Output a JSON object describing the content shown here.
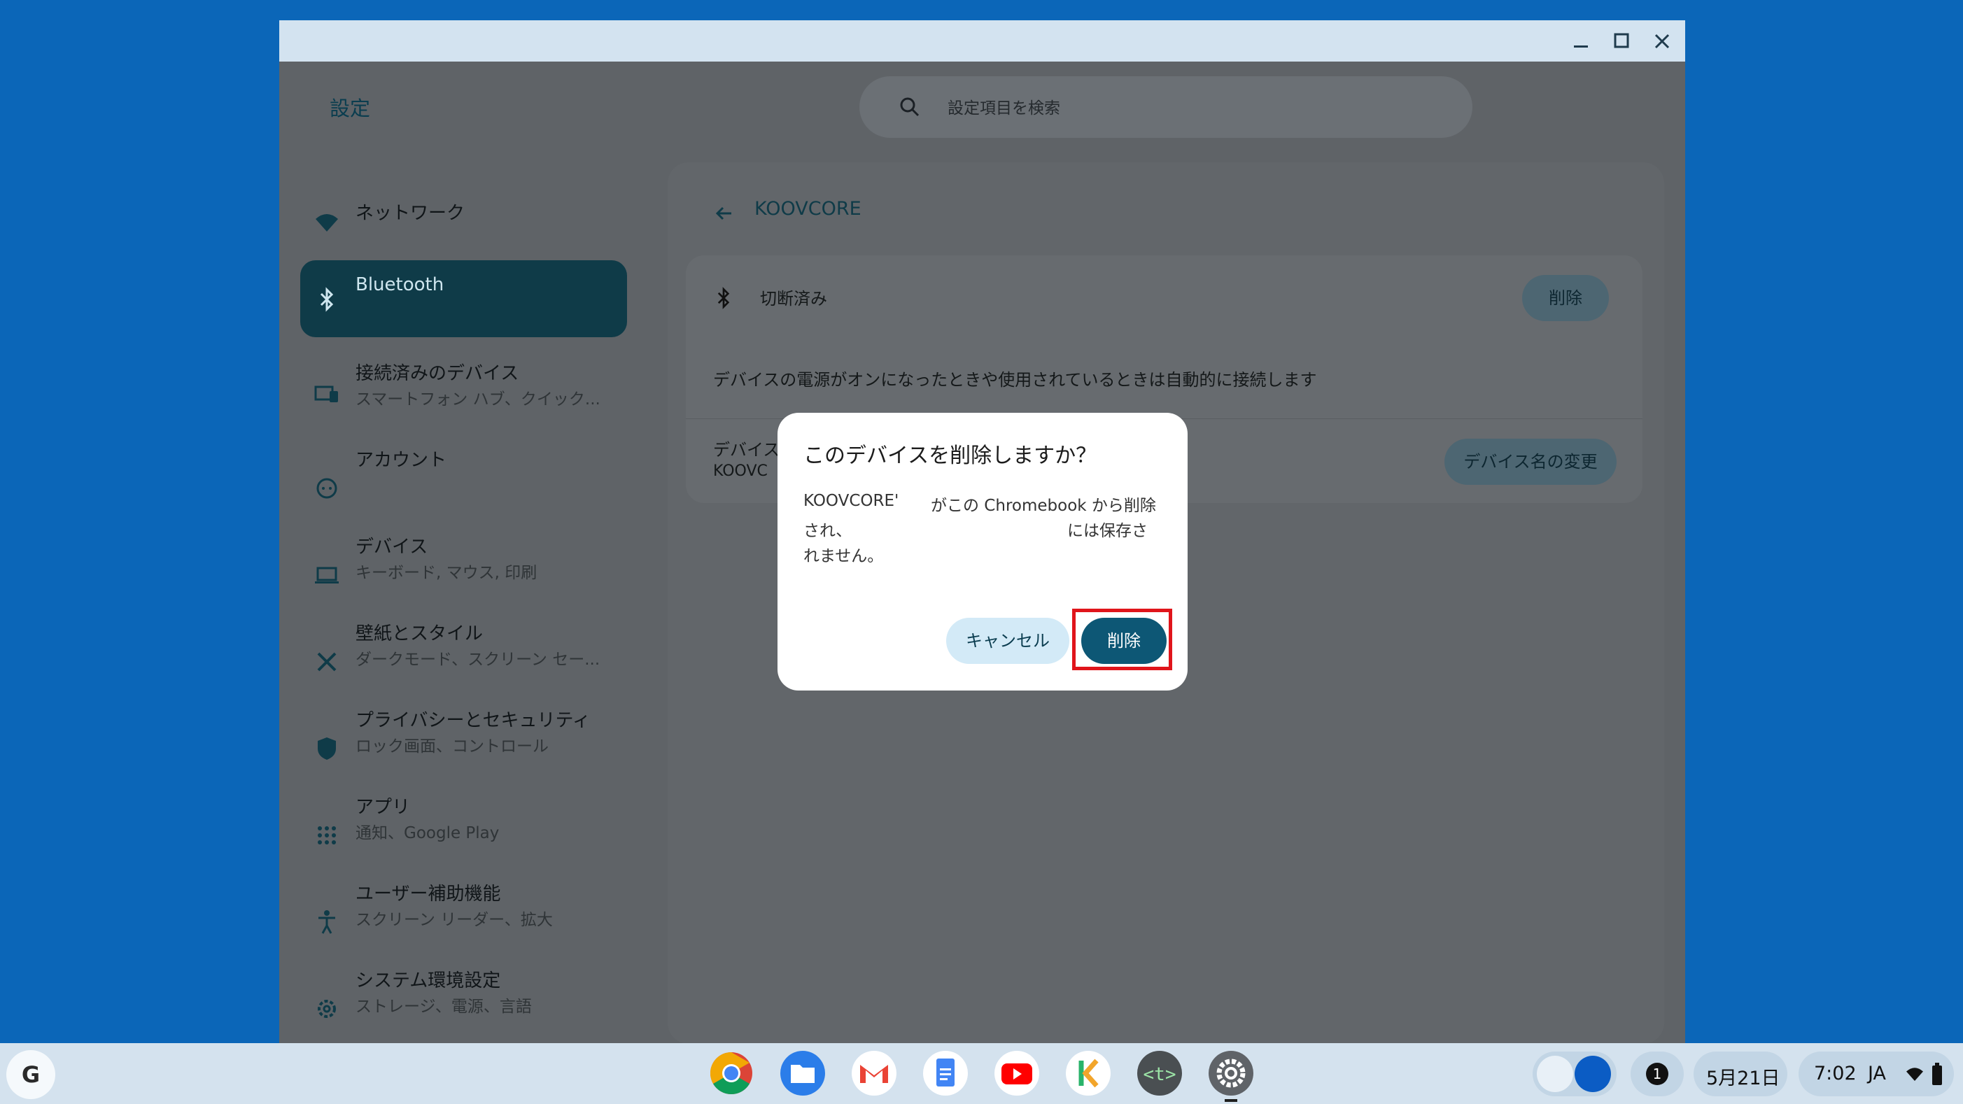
{
  "window": {
    "app_title": "設定",
    "search_placeholder": "設定項目を検索"
  },
  "sidebar": {
    "items": [
      {
        "title": "ネットワーク",
        "subtitle": "",
        "icon": "wifi-icon"
      },
      {
        "title": "Bluetooth",
        "subtitle": "",
        "icon": "bluetooth-icon",
        "selected": true
      },
      {
        "title": "接続済みのデバイス",
        "subtitle": "スマートフォン ハブ、クイック...",
        "icon": "connected-devices-icon"
      },
      {
        "title": "アカウント",
        "subtitle": "",
        "icon": "account-icon"
      },
      {
        "title": "デバイス",
        "subtitle": "キーボード, マウス, 印刷",
        "icon": "laptop-icon"
      },
      {
        "title": "壁紙とスタイル",
        "subtitle": "ダークモード、スクリーン セー...",
        "icon": "palette-icon"
      },
      {
        "title": "プライバシーとセキュリティ",
        "subtitle": "ロック画面、コントロール",
        "icon": "shield-icon"
      },
      {
        "title": "アプリ",
        "subtitle": "通知、Google Play",
        "icon": "apps-grid-icon"
      },
      {
        "title": "ユーザー補助機能",
        "subtitle": "スクリーン リーダー、拡大",
        "icon": "accessibility-icon"
      },
      {
        "title": "システム環境設定",
        "subtitle": "ストレージ、電源、言語",
        "icon": "gear-icon"
      }
    ]
  },
  "main": {
    "page_title": "KOOVCORE",
    "status": "切断済み",
    "remove_label": "削除",
    "auto_connect_text": "デバイスの電源がオンになったときや使用されているときは自動的に接続します",
    "device_name_label": "デバイス",
    "device_name_value": "KOOVC",
    "rename_label": "デバイス名の変更"
  },
  "dialog": {
    "title": "このデバイスを削除しますか？",
    "line1a": "KOOVCORE'",
    "line1b": "がこの Chromebook から削除",
    "line2a": "され、",
    "line2b": "には保存さ",
    "line3": "れません。",
    "cancel_label": "キャンセル",
    "delete_label": "削除"
  },
  "shelf": {
    "launcher_label": "G",
    "apps": [
      "chrome-icon",
      "files-icon",
      "gmail-icon",
      "docs-icon",
      "youtube-icon",
      "k-app-icon",
      "terminal-icon",
      "settings-icon"
    ],
    "notification_count": "1",
    "date": "5月21日",
    "time": "7:02",
    "ime": "JA"
  },
  "colors": {
    "desktop": "#0b66b8",
    "dialog_delete": "#0d5775",
    "highlight": "#e0151b"
  }
}
